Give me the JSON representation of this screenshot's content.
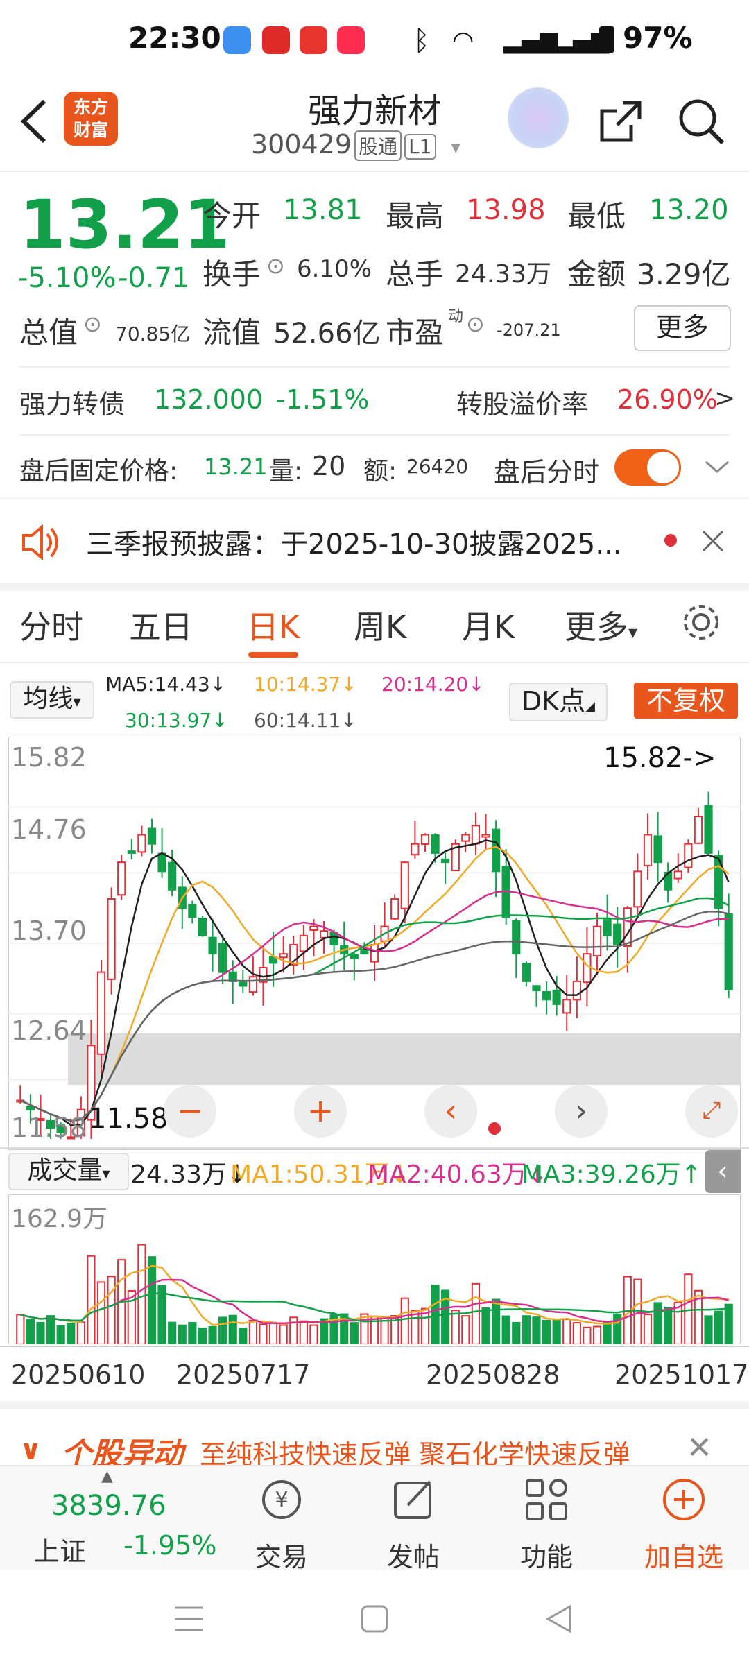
{
  "status_bar": {
    "time": "22:30",
    "icons_right": "97%"
  },
  "header": {
    "logo_line1": "东方",
    "logo_line2": "财富",
    "title": "强力新材",
    "code": "300429",
    "tag_tong": "股通",
    "tag_level": "L1"
  },
  "quote": {
    "price": "13.21",
    "pct": "-5.10%",
    "change": "-0.71",
    "open_label": "今开",
    "open": "13.81",
    "high_label": "最高",
    "high": "13.98",
    "low_label": "最低",
    "low": "13.20",
    "turnover_label": "换手",
    "turnover": "6.10%",
    "volume_label": "总手",
    "volume": "24.33万",
    "amount_label": "金额",
    "amount": "3.29亿",
    "mcap_label": "总值",
    "mcap": "70.85亿",
    "float_label": "流值",
    "float": "52.66亿",
    "pe_label": "市盈",
    "pe_sup": "动",
    "pe": "-207.21",
    "more_button": "更多"
  },
  "bond": {
    "name": "强力转债",
    "price": "132.000",
    "pct": "-1.51%",
    "premium_label": "转股溢价率",
    "premium": "26.90%",
    "arrow": ">"
  },
  "after_hours": {
    "label": "盘后固定价格:",
    "price": "13.21",
    "vol_label": "量:",
    "vol": "20",
    "amt_label": "额:",
    "amt": "26420",
    "toggle_label": "盘后分时"
  },
  "notice": {
    "text": "三季报预披露：于2025-10-30披露2025..."
  },
  "tabs": [
    {
      "label": "分时"
    },
    {
      "label": "五日"
    },
    {
      "label": "日K"
    },
    {
      "label": "周K"
    },
    {
      "label": "月K"
    },
    {
      "label": "更多"
    }
  ],
  "kline": {
    "ma_select": "均线",
    "ma5": "MA5:14.43↓",
    "ma10": "10:14.37↓",
    "ma20": "20:14.20↓",
    "ma30": "30:13.97↓",
    "ma60": "60:14.11↓",
    "dk_button": "DK点",
    "fq_button": "不复权",
    "y_labels": [
      "15.82",
      "14.76",
      "13.70",
      "12.64",
      "11.58"
    ],
    "max_marker": "15.82->",
    "min_marker": "11.58",
    "colors": {
      "up": "#e0303a",
      "down": "#12a14a",
      "ma5": "#222222",
      "ma10": "#f0a928",
      "ma20": "#d6308f",
      "ma30": "#12a14a",
      "ma60": "#666666"
    }
  },
  "volume": {
    "select": "成交量",
    "current": "24.33万↓",
    "ma1": "MA1:50.31万↓",
    "ma2": "MA2:40.63万↓",
    "ma3": "MA3:39.26万↑",
    "max_label": "162.9万",
    "dates": [
      "20250610",
      "20250717",
      "20250828",
      "20251017"
    ]
  },
  "hot_bar": {
    "title": "个股异动",
    "text": "至纯科技快速反弹 聚石化学快速反弹"
  },
  "bottom_nav": {
    "index_value": "3839.76",
    "index_name": "上证",
    "index_pct": "-1.95%",
    "items": [
      {
        "label": "交易"
      },
      {
        "label": "发帖"
      },
      {
        "label": "功能"
      },
      {
        "label": "加自选"
      }
    ]
  }
}
